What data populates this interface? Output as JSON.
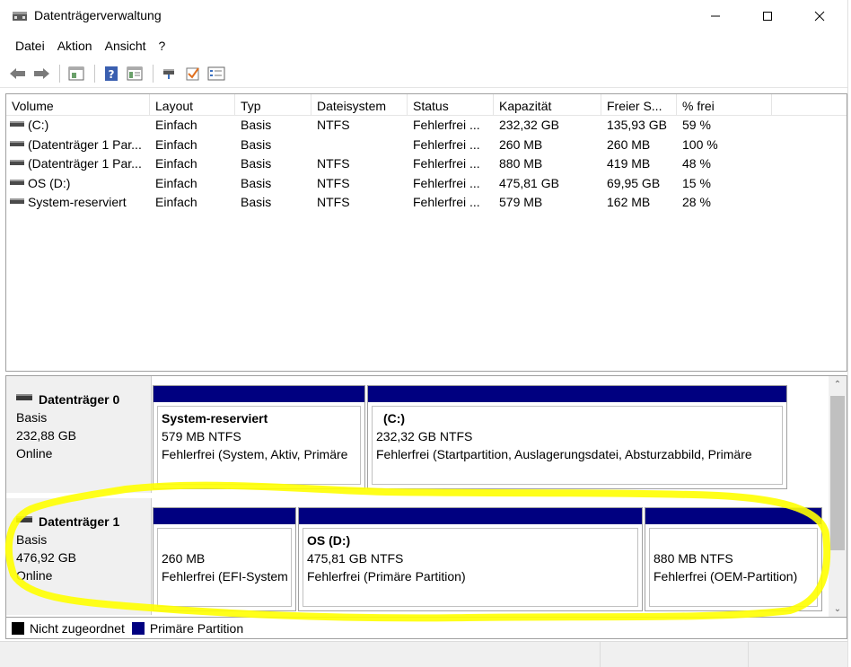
{
  "window": {
    "title": "Datenträgerverwaltung"
  },
  "menu": [
    "Datei",
    "Aktion",
    "Ansicht",
    "?"
  ],
  "toolbar_icons": [
    "back-icon",
    "forward-icon",
    "properties-icon",
    "help-icon",
    "console-tree-icon",
    "connect-icon",
    "check-icon",
    "list-icon"
  ],
  "volumes": {
    "columns": [
      "Volume",
      "Layout",
      "Typ",
      "Dateisystem",
      "Status",
      "Kapazität",
      "Freier S...",
      "% frei"
    ],
    "rows": [
      [
        "(C:)",
        "Einfach",
        "Basis",
        "NTFS",
        "Fehlerfrei ...",
        "232,32 GB",
        "135,93 GB",
        "59 %"
      ],
      [
        "(Datenträger 1 Par...",
        "Einfach",
        "Basis",
        "",
        "Fehlerfrei ...",
        "260 MB",
        "260 MB",
        "100 %"
      ],
      [
        "(Datenträger 1 Par...",
        "Einfach",
        "Basis",
        "NTFS",
        "Fehlerfrei ...",
        "880 MB",
        "419 MB",
        "48 %"
      ],
      [
        "OS (D:)",
        "Einfach",
        "Basis",
        "NTFS",
        "Fehlerfrei ...",
        "475,81 GB",
        "69,95 GB",
        "15 %"
      ],
      [
        "System-reserviert",
        "Einfach",
        "Basis",
        "NTFS",
        "Fehlerfrei ...",
        "579 MB",
        "162 MB",
        "28 %"
      ]
    ]
  },
  "disks": [
    {
      "name": "Datenträger 0",
      "type": "Basis",
      "size": "232,88 GB",
      "state": "Online",
      "partitions": [
        {
          "title": "System-reserviert",
          "size": "579 MB NTFS",
          "status": "Fehlerfrei (System, Aktiv, Primäre"
        },
        {
          "title": "(C:)",
          "size": "232,32 GB NTFS",
          "status": "Fehlerfrei (Startpartition, Auslagerungsdatei, Absturzabbild, Primäre"
        }
      ]
    },
    {
      "name": "Datenträger 1",
      "type": "Basis",
      "size": "476,92 GB",
      "state": "Online",
      "partitions": [
        {
          "title": "",
          "size": "260 MB",
          "status": "Fehlerfrei (EFI-System"
        },
        {
          "title": "OS  (D:)",
          "size": "475,81 GB NTFS",
          "status": "Fehlerfrei (Primäre Partition)"
        },
        {
          "title": "",
          "size": "880 MB NTFS",
          "status": "Fehlerfrei (OEM-Partition)"
        }
      ]
    }
  ],
  "legend": [
    {
      "label": "Nicht zugeordnet",
      "color": "#000000"
    },
    {
      "label": "Primäre Partition",
      "color": "#000080"
    }
  ],
  "colors": {
    "partition_bar": "#000080",
    "highlight": "#ffff00"
  }
}
